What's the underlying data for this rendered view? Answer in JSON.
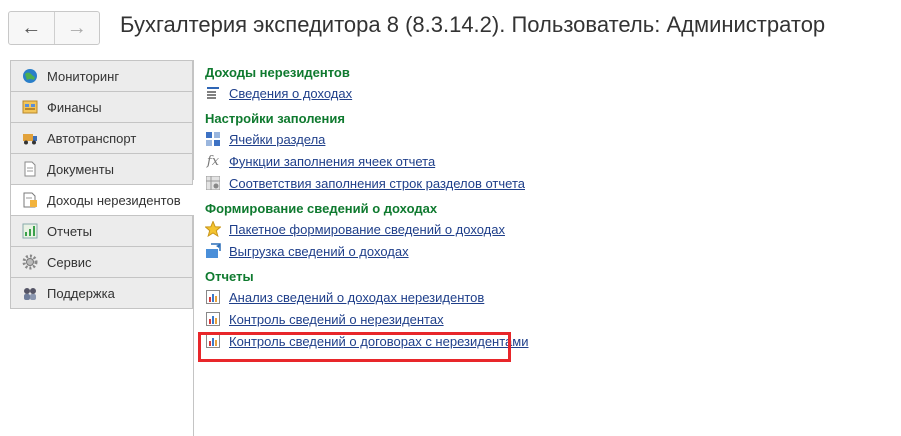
{
  "header": {
    "back_glyph": "←",
    "forward_glyph": "→",
    "title": "Бухгалтерия экспедитора 8 (8.3.14.2). Пользователь: Администратор"
  },
  "sidebar": {
    "items": [
      {
        "label": "Мониторинг",
        "icon": "globe-icon"
      },
      {
        "label": "Финансы",
        "icon": "finance-icon"
      },
      {
        "label": "Автотранспорт",
        "icon": "truck-icon"
      },
      {
        "label": "Документы",
        "icon": "document-icon"
      },
      {
        "label": "Доходы нерезидентов",
        "icon": "income-icon",
        "active": true
      },
      {
        "label": "Отчеты",
        "icon": "chart-icon"
      },
      {
        "label": "Сервис",
        "icon": "gear-icon"
      },
      {
        "label": "Поддержка",
        "icon": "support-icon"
      }
    ]
  },
  "sections": [
    {
      "title": "Доходы нерезидентов",
      "links": [
        {
          "label": "Сведения о доходах",
          "icon": "list-icon"
        }
      ]
    },
    {
      "title": "Настройки заполения",
      "links": [
        {
          "label": "Ячейки раздела",
          "icon": "cells-icon"
        },
        {
          "label": "Функции заполнения ячеек отчета",
          "icon": "fx-icon"
        },
        {
          "label": "Соответствия заполнения строк разделов отчета",
          "icon": "mapping-icon"
        }
      ]
    },
    {
      "title": "Формирование сведений о доходах",
      "links": [
        {
          "label": "Пакетное формирование сведений о доходах",
          "icon": "star-icon"
        },
        {
          "label": "Выгрузка сведений о доходах",
          "icon": "export-icon"
        }
      ]
    },
    {
      "title": "Отчеты",
      "links": [
        {
          "label": "Анализ сведений о доходах нерезидентов",
          "icon": "report-icon",
          "highlighted": true
        },
        {
          "label": "Контроль сведений о нерезидентах",
          "icon": "report-icon"
        },
        {
          "label": "Контроль сведений о договорах с нерезидентами",
          "icon": "report-icon"
        }
      ]
    }
  ],
  "colors": {
    "section_title": "#0f7a2f",
    "link": "#1f3f8a",
    "highlight": "#e8262a"
  }
}
